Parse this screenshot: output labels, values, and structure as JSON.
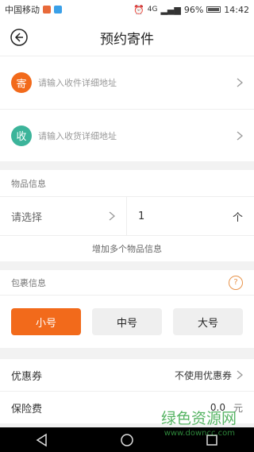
{
  "status_bar": {
    "carrier": "中国移动",
    "network": "4G",
    "battery": "96%",
    "time": "14:42"
  },
  "header": {
    "title": "预约寄件"
  },
  "sender": {
    "badge": "寄",
    "placeholder": "请输入收件详细地址",
    "color": "#f26a1b"
  },
  "receiver": {
    "badge": "收",
    "placeholder": "请输入收货详细地址",
    "color": "#3cb49a"
  },
  "item_info": {
    "section_title": "物品信息",
    "select_label": "请选择",
    "quantity": "1",
    "unit": "个",
    "add_more": "增加多个物品信息"
  },
  "package_info": {
    "section_title": "包裹信息",
    "help": "?",
    "sizes": [
      {
        "label": "小号",
        "selected": true
      },
      {
        "label": "中号",
        "selected": false
      },
      {
        "label": "大号",
        "selected": false
      }
    ]
  },
  "coupon": {
    "label": "优惠券",
    "value": "不使用优惠券"
  },
  "insurance": {
    "label": "保险费",
    "value": "0.0",
    "unit": "元"
  },
  "watermark": {
    "text": "绿色资源网",
    "url": "www.downcc.com"
  },
  "colors": {
    "accent": "#f26a1b",
    "green": "#3cb49a"
  }
}
